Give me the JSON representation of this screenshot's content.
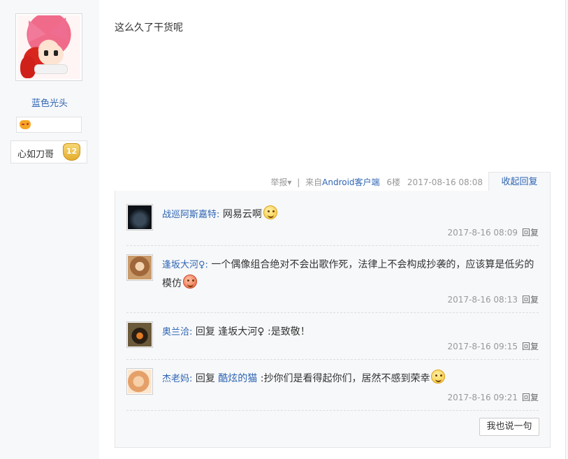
{
  "author": {
    "username": "蓝色光头",
    "badge_icon": "game-controller-icon",
    "level_name": "心如刀哥",
    "level_number": "12"
  },
  "post": {
    "content": "这么久了干货呢",
    "report_label": "举报",
    "report_arrow": "▾",
    "separator": "|",
    "from_prefix": "来自",
    "client_link": "Android客户端",
    "floor": "6楼",
    "datetime": "2017-08-16 08:08",
    "collapse_label": "收起回复"
  },
  "replies": [
    {
      "name": "战巡阿斯嘉特:",
      "text": " 网易云啊",
      "emoji": "smile-yellow",
      "time": "2017-8-16 08:09",
      "reply_label": "回复"
    },
    {
      "name": "逢坂大河♀:",
      "text": " 一个偶像组合绝对不会出歌作死，法律上不会构成抄袭的，应该算是低劣的模仿",
      "emoji": "smile-red",
      "time": "2017-8-16 08:13",
      "reply_label": "回复"
    },
    {
      "name": "奥兰洽:",
      "text": " 回复 逢坂大河♀ :是致敬！",
      "time": "2017-8-16 09:15",
      "reply_label": "回复"
    },
    {
      "name": "杰老妈:",
      "text_prefix": " 回复 ",
      "mention": "酷炫的猫",
      "text_suffix": " :抄你们是看得起你们，居然不感到荣幸",
      "emoji": "smile-yellow",
      "time": "2017-8-16 09:21",
      "reply_label": "回复"
    }
  ],
  "say_button_label": "我也说一句",
  "colors": {
    "link": "#2d64b3",
    "panel_bg": "#f7f8fa",
    "meta": "#999999"
  }
}
